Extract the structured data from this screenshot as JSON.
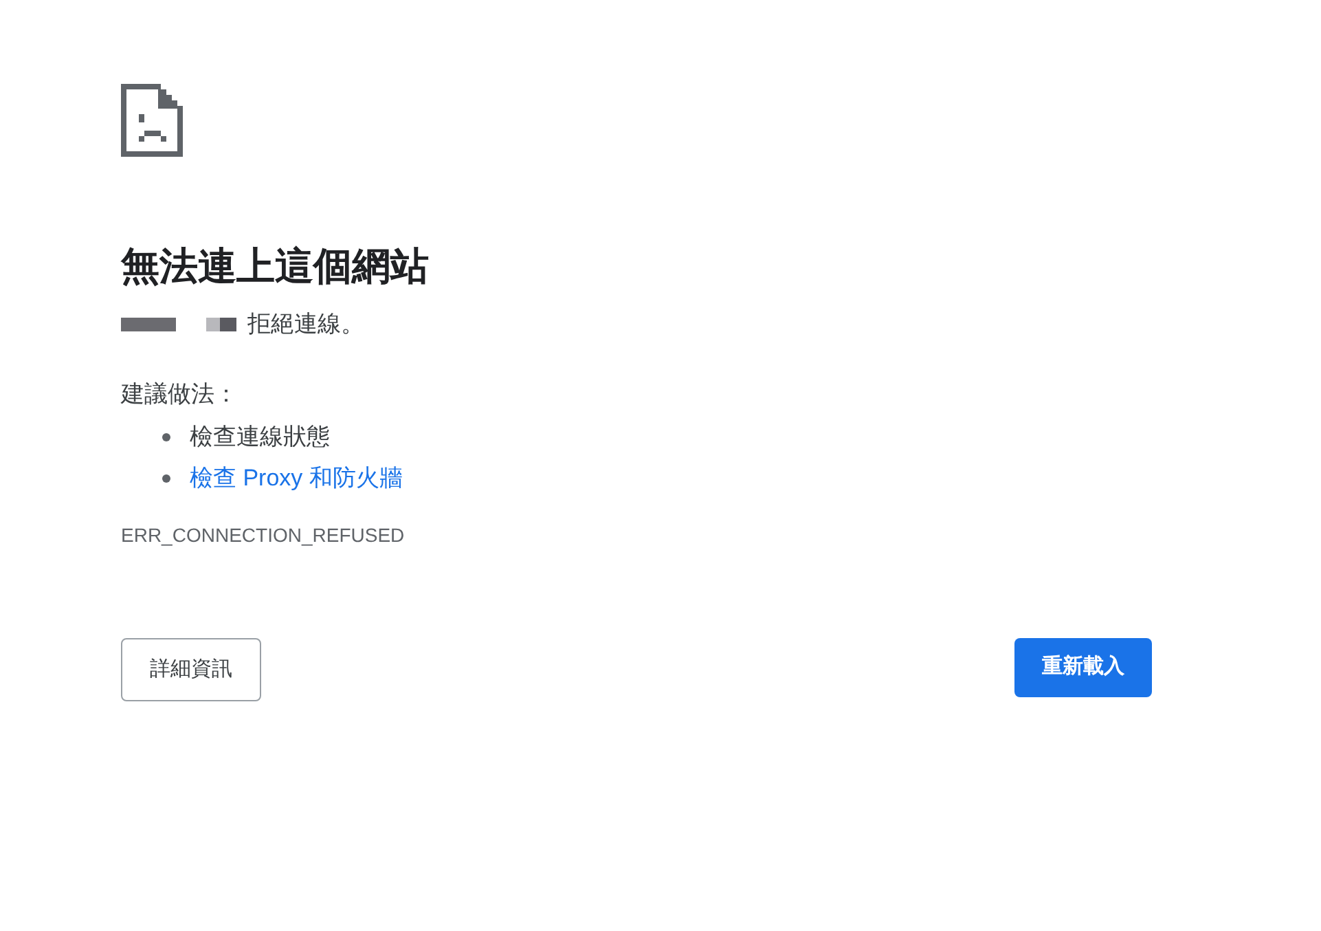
{
  "heading": "無法連上這個網站",
  "message": "拒絕連線。",
  "suggestions_title": "建議做法：",
  "suggestions": [
    {
      "kind": "text",
      "label": "檢查連線狀態"
    },
    {
      "kind": "link",
      "label": "檢查 Proxy 和防火牆"
    }
  ],
  "error_code": "ERR_CONNECTION_REFUSED",
  "buttons": [
    {
      "kind": "secondary",
      "label": "詳細資訊"
    },
    {
      "kind": "primary",
      "label": "重新載入"
    }
  ]
}
